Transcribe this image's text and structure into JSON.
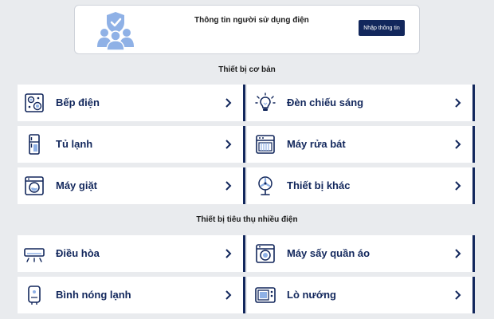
{
  "user_card": {
    "title": "Thông tin người sử dụng điện",
    "button_label": "Nhập thông tin",
    "icon": "users-shield-icon"
  },
  "sections": [
    {
      "title": "Thiết bị cơ bản",
      "items": [
        {
          "label": "Bếp điện",
          "icon": "stove-icon"
        },
        {
          "label": "Đèn chiếu sáng",
          "icon": "light-bulb-icon"
        },
        {
          "label": "Tủ lạnh",
          "icon": "fridge-icon"
        },
        {
          "label": "Máy rửa bát",
          "icon": "dishwasher-icon"
        },
        {
          "label": "Máy giặt",
          "icon": "washing-machine-icon"
        },
        {
          "label": "Thiết bị khác",
          "icon": "fan-icon"
        }
      ]
    },
    {
      "title": "Thiết bị tiêu thụ nhiều điện",
      "items": [
        {
          "label": "Điều hòa",
          "icon": "air-conditioner-icon"
        },
        {
          "label": "Máy sấy quần áo",
          "icon": "clothes-dryer-icon"
        },
        {
          "label": "Bình nóng lạnh",
          "icon": "water-heater-icon"
        },
        {
          "label": "Lò nướng",
          "icon": "oven-icon"
        }
      ]
    }
  ],
  "colors": {
    "background": "#e9ebee",
    "card": "#ffffff",
    "accent": "#12275c",
    "icon_light": "#8fb1e6"
  }
}
